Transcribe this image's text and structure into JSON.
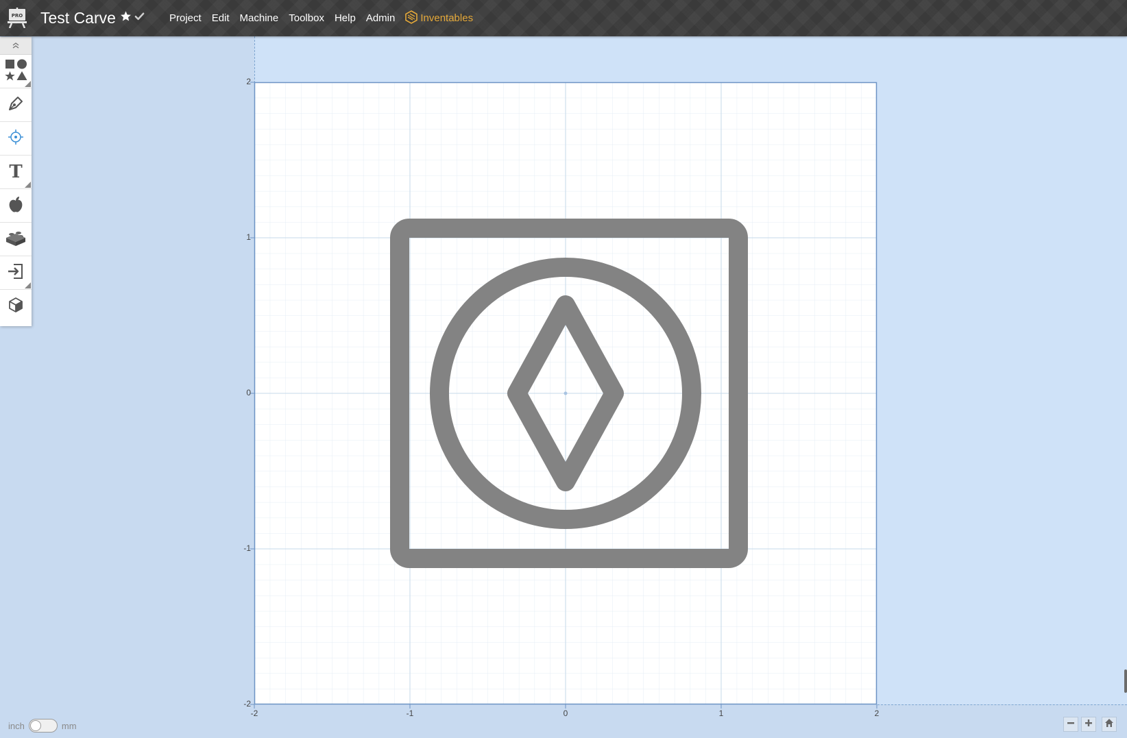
{
  "header": {
    "badge": "PRO",
    "title": "Test Carve",
    "menu": [
      "Project",
      "Edit",
      "Machine",
      "Toolbox",
      "Help",
      "Admin"
    ],
    "brand_label": "Inventables",
    "brand_color": "#e5a93a"
  },
  "toolbar": {
    "items": [
      {
        "name": "shapes-icon"
      },
      {
        "name": "pen-tool-icon"
      },
      {
        "name": "point-tool-icon"
      },
      {
        "name": "text-tool-icon",
        "glyph": "T"
      },
      {
        "name": "apple-icon"
      },
      {
        "name": "lego-brick-icon"
      },
      {
        "name": "import-icon"
      },
      {
        "name": "3d-box-icon"
      }
    ]
  },
  "canvas": {
    "x_ticks": [
      "-2",
      "-1",
      "0",
      "1",
      "2"
    ],
    "y_ticks": [
      "2",
      "1",
      "0",
      "-1",
      "-2"
    ],
    "design_color": "#838383"
  },
  "footer": {
    "unit_left": "inch",
    "unit_right": "mm"
  }
}
